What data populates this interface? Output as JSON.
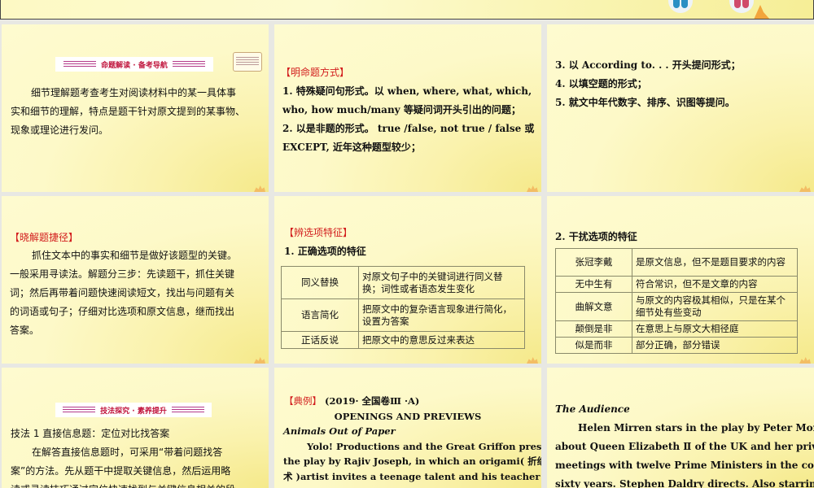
{
  "slides": [
    {
      "banner": "命题解读 · 备考导航",
      "lines": [
        "细节理解题考查考生对阅读材料中的某一具体事",
        "实和细节的理解，特点是题干针对原文提到的某事物、",
        "现象或理论进行发问。"
      ]
    },
    {
      "heading": "【明命题方式】",
      "lines": [
        "1.  特殊疑问句形式。以 when,  where,  what,  which,",
        "who,  how much/many 等疑问词开头引出的问题；",
        "2.  以是非题的形式。 true /false,  not true / false 或",
        "EXCEPT,  近年这种题型较少；"
      ]
    },
    {
      "lines": [
        "3.  以 According to. . .   开头提问形式；",
        "4.  以填空题的形式；",
        "5.  就文中年代数字、排序、识图等提问。"
      ]
    },
    {
      "heading": "【晓解题捷径】",
      "lines": [
        "抓住文本中的事实和细节是做好该题型的关键。",
        "一般采用寻读法。解题分三步：先读题干，抓住关键",
        "词；然后再带着问题快速阅读短文，找出与问题有关",
        "的词语或句子；仔细对比选项和原文信息，继而找出",
        "答案。"
      ]
    },
    {
      "heading": "【辨选项特征】",
      "subheading": "1.  正确选项的特征",
      "table": [
        [
          "同义替换",
          "对原文句子中的关键词进行同义替换；词性或者语态发生变化"
        ],
        [
          "语言简化",
          "把原文中的复杂语言现象进行简化，设置为答案"
        ],
        [
          "正话反说",
          "把原文中的意思反过来表达"
        ]
      ]
    },
    {
      "subheading": "2.  干扰选项的特征",
      "table": [
        [
          "张冠李戴",
          "是原文信息，但不是题目要求的内容"
        ],
        [
          "无中生有",
          "符合常识，但不是文章的内容"
        ],
        [
          "曲解文意",
          "与原文的内容极其相似，只是在某个细节处有些变动"
        ],
        [
          "颠倒是非",
          "在意思上与原文大相径庭"
        ],
        [
          "似是而非",
          "部分正确，部分错误"
        ]
      ]
    },
    {
      "banner": "技法探究 · 素养提升",
      "heading": "技法 1      直接信息题：定位对比找答案",
      "lines": [
        "在解答直接信息题时，可采用“带着问题找答",
        "案”的方法。先从题干中提取关键信息，然后运用略",
        "读或寻读技巧通过定位快速找到与关键信息相关的段"
      ]
    },
    {
      "tag": "【典例】",
      "source": "(2019· 全国卷Ⅲ ·A)",
      "title": "OPENINGS AND PREVIEWS",
      "subtitle": "Animals Out of Paper",
      "lines": [
        "Yolo! Productions and the Great Griffon present",
        "the play by Rajiv Joseph, in which an origami( 折纸",
        "术 )artist invites a teenage talent and his teacher into"
      ]
    },
    {
      "subtitle": "The Audience",
      "lines": [
        "Helen Mirren stars in the play by Peter Morgan,",
        "about Queen Elizabeth Ⅱ of the UK and her private",
        "meetings with twelve Prime Ministers in the course of",
        "sixty years. Stephen Daldry directs. Also starring Dylan"
      ]
    }
  ]
}
